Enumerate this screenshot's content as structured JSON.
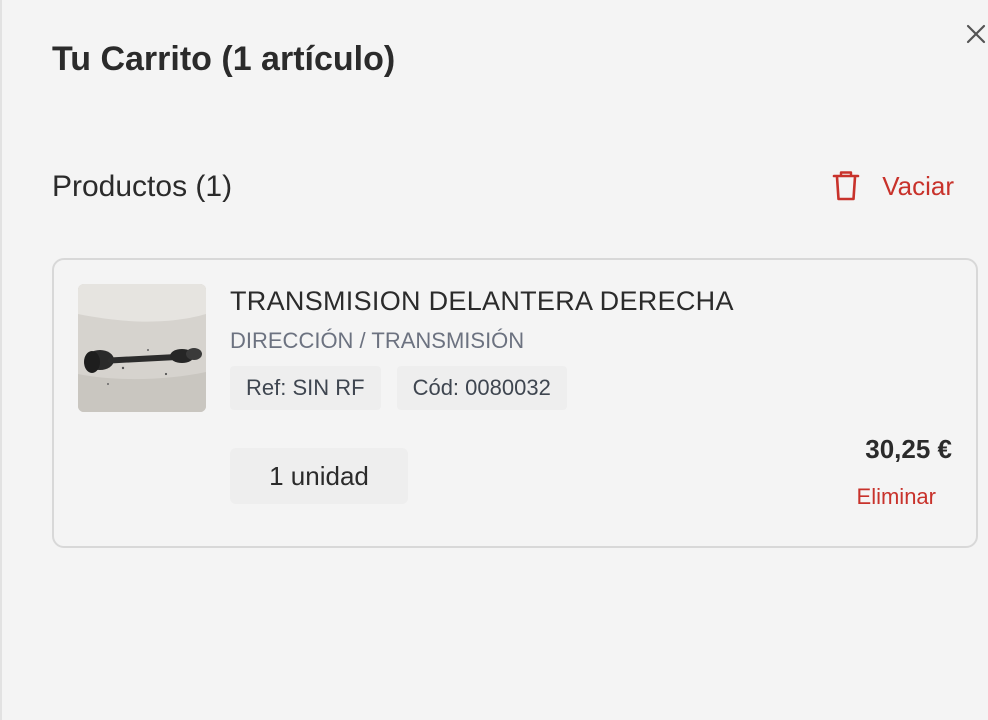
{
  "cart": {
    "title": "Tu Carrito (1 artículo)",
    "close_icon": "close-icon"
  },
  "products": {
    "heading": "Productos (1)",
    "empty_label": "Vaciar",
    "empty_icon": "trash-icon"
  },
  "items": [
    {
      "name": "TRANSMISION DELANTERA DERECHA",
      "category": "DIRECCIÓN / TRANSMISIÓN",
      "ref": "Ref: SIN RF",
      "code": "Cód: 0080032",
      "quantity": "1 unidad",
      "price": "30,25 €",
      "remove_label": "Eliminar",
      "image": "drive-shaft-photo"
    }
  ],
  "colors": {
    "accent": "#c8322b",
    "text": "#2b2b2b",
    "muted": "#6c7280",
    "background": "#f4f4f4",
    "border": "#d8d8d8"
  }
}
